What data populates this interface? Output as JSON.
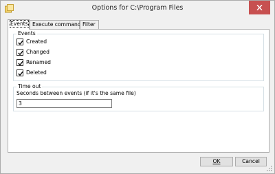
{
  "window": {
    "title": "Options for C:\\Program Files",
    "app_icon": "app-icon",
    "close_icon": "close-icon"
  },
  "tabs": [
    {
      "label": "Events",
      "selected": true
    },
    {
      "label": "Execute command",
      "selected": false
    },
    {
      "label": "Filter",
      "selected": false
    }
  ],
  "events_group": {
    "title": "Events",
    "checkboxes": [
      {
        "label": "Created",
        "checked": true
      },
      {
        "label": "Changed",
        "checked": true
      },
      {
        "label": "Renamed",
        "checked": true
      },
      {
        "label": "Deleted",
        "checked": true
      }
    ]
  },
  "timeout_group": {
    "title": "Time out",
    "field_label": "Seconds between events (if it's the same file)",
    "value": "3"
  },
  "buttons": {
    "ok_label": "OK",
    "cancel_label": "Cancel"
  }
}
